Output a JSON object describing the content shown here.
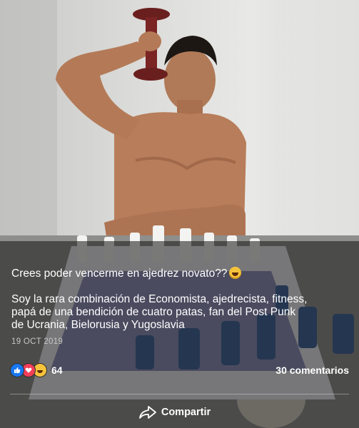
{
  "post": {
    "caption_line1": "Crees poder vencerme en ajedrez novato??",
    "caption_line2": "Soy la rara combinación de Economista, ajedrecista, fitness,",
    "caption_line3": "papá de una bendición de cuatro patas, fan del Post Punk",
    "caption_line4": "de Ucrania, Bielorusia y Yugoslavia",
    "date": "19 OCT 2019",
    "emoji_icon": "grinning-squinting-face-icon"
  },
  "engagement": {
    "reaction_icons": [
      "like-icon",
      "love-icon",
      "haha-icon"
    ],
    "reaction_count": "64",
    "comments_label": "30 comentarios"
  },
  "actions": {
    "share_label": "Compartir"
  },
  "colors": {
    "like": "#1877f2",
    "love": "#f33e58",
    "haha": "#f7c33b",
    "overlay": "#141414"
  }
}
